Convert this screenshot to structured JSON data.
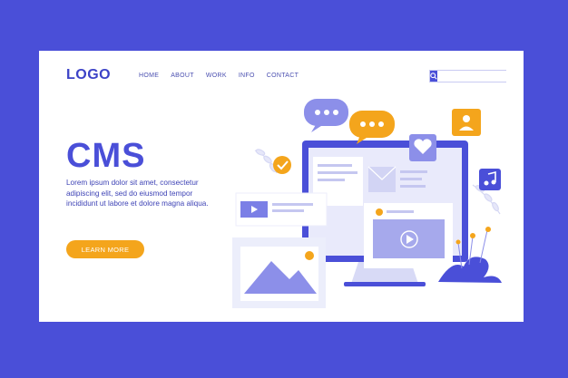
{
  "header": {
    "logo": "LOGO",
    "nav": [
      "HOME",
      "ABOUT",
      "WORK",
      "INFO",
      "CONTACT"
    ],
    "search": {
      "placeholder": "",
      "value": ""
    }
  },
  "hero": {
    "title": "CMS",
    "body": "Lorem ipsum dolor sit amet, consectetur adipiscing elit, sed do eiusmod tempor incididunt ut labore et dolore magna aliqua.",
    "cta_label": "LEARN MORE"
  },
  "colors": {
    "background": "#4a4fd8",
    "card": "#ffffff",
    "primary": "#4a4fd8",
    "accent": "#f4a51c",
    "light_primary": "#e4e5fb"
  },
  "icons": [
    "search-icon",
    "chat-bubble-icon",
    "user-icon",
    "heart-icon",
    "music-note-icon",
    "check-icon",
    "play-icon",
    "image-icon"
  ]
}
